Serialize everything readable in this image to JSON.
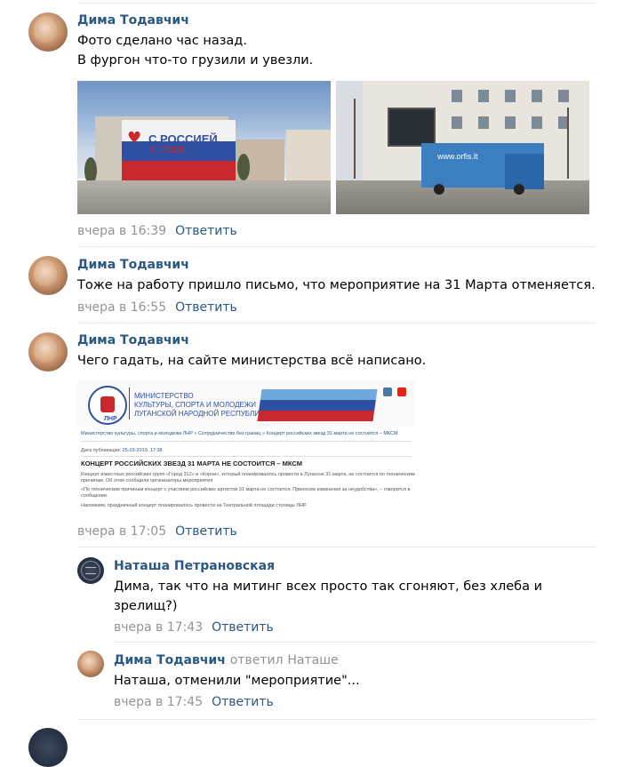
{
  "comments": [
    {
      "author": "Дима Тодавчич",
      "lines": [
        "Фото сделано час назад.",
        "В фургон что-то грузили и увезли."
      ],
      "date": "вчера в 16:39",
      "reply_label": "Ответить"
    },
    {
      "author": "Дима Тодавчич",
      "lines": [
        "Тоже на работу пришло письмо, что мероприятие на 31 Марта отменяется."
      ],
      "date": "вчера в 16:55",
      "reply_label": "Ответить"
    },
    {
      "author": "Дима Тодавчич",
      "lines": [
        "Чего гадать, на сайте министерства всё написано."
      ],
      "date": "вчера в 17:05",
      "reply_label": "Ответить"
    },
    {
      "author": "Наташа Петрановская",
      "lines": [
        "Дима, так что на митинг всех просто так сгоняют, без хлеба и",
        "зрелищ?)"
      ],
      "date": "вчера в 17:43",
      "reply_label": "Ответить"
    },
    {
      "author": "Дима Тодавчич",
      "replied_word": "ответил",
      "replied_to": "Наташе",
      "lines": [
        "Наташа, отменили \"мероприятие\"..."
      ],
      "date": "вчера в 17:45",
      "reply_label": "Ответить"
    }
  ],
  "photo1": {
    "banner_main": "С РОССИЕЙ",
    "banner_sub": "В СЕРДЦЕ"
  },
  "photo2": {
    "truck_text": "www.orfis.lt"
  },
  "ministry_page": {
    "title_lines": [
      "МИНИСТЕРСТВО",
      "КУЛЬТУРЫ, СПОРТА И МОЛОДЕЖИ",
      "ЛУГАНСКОЙ НАРОДНОЙ РЕСПУБЛИКИ"
    ],
    "logo_text": "ЛНР",
    "breadcrumb": "Министерство культуры, спорта и молодежи ЛНР » Сотрудничество без границ » Концерт российских звезд 31 марта не состоится – МКСМ",
    "date_label": "Дата публикации:",
    "date_value": "25-03-2019, 17:38",
    "headline": "КОНЦЕРТ РОССИЙСКИХ ЗВЕЗД 31 МАРТА НЕ СОСТОИТСЯ – МКСМ",
    "para1a": "Концерт известных российских групп «Город 312» и «Корни», который планировалось провести в Луганске 31 марта, не состоится по техническим",
    "para1b": "причинам. Об этом сообщили организаторы мероприятия.",
    "para2a": "«По техническим причинам концерт с участием российских артистов 31 марта не состоится. Приносим извинения за неудобства», – говорится в",
    "para2b": "сообщении.",
    "para3": "Напомним, праздничный концерт планировалось провести на Театральной площади столицы ЛНР."
  },
  "colors": {
    "link": "#2a5885",
    "muted": "#939393",
    "divider": "#e7e8ec"
  }
}
